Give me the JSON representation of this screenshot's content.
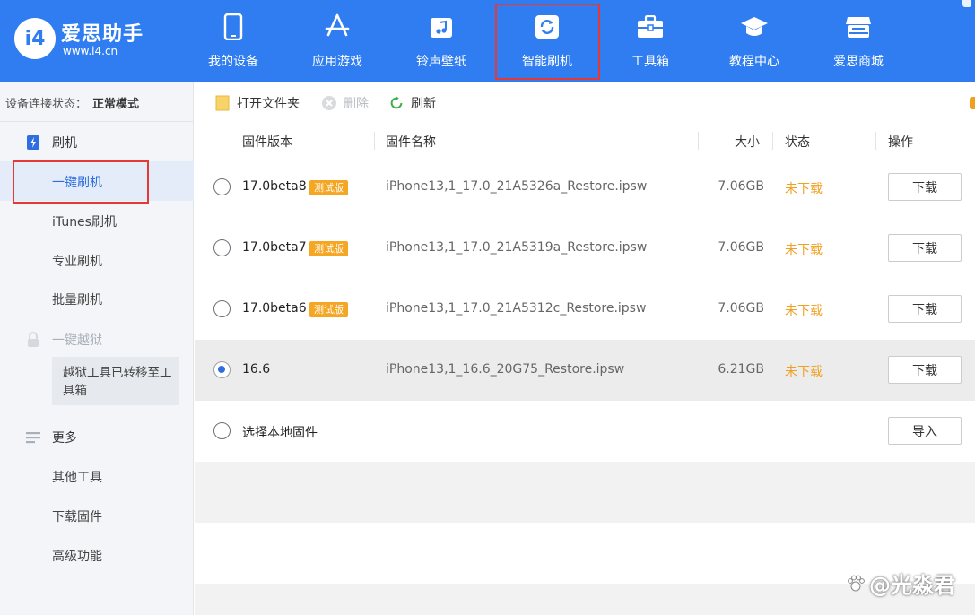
{
  "app": {
    "logo_mark": "i4",
    "name": "爱思助手",
    "url": "www.i4.cn"
  },
  "nav": [
    {
      "label": "我的设备",
      "icon": "phone-icon"
    },
    {
      "label": "应用游戏",
      "icon": "app-store-icon"
    },
    {
      "label": "铃声壁纸",
      "icon": "music-icon"
    },
    {
      "label": "智能刷机",
      "icon": "refresh-flash-icon",
      "active": true
    },
    {
      "label": "工具箱",
      "icon": "toolbox-icon"
    },
    {
      "label": "教程中心",
      "icon": "graduation-cap-icon"
    },
    {
      "label": "爱思商城",
      "icon": "shop-icon"
    }
  ],
  "sidebar": {
    "status_label": "设备连接状态：",
    "status_value": "正常模式",
    "groups": {
      "flash": {
        "label": "刷机",
        "icon": "flash-icon"
      },
      "jailbreak": {
        "label": "一键越狱",
        "icon": "lock-icon"
      },
      "more": {
        "label": "更多",
        "icon": "menu-icon"
      }
    },
    "items": {
      "one_click_flash": "一键刷机",
      "itunes_flash": "iTunes刷机",
      "pro_flash": "专业刷机",
      "batch_flash": "批量刷机",
      "jailbreak_note": "越狱工具已转移至工具箱",
      "other_tools": "其他工具",
      "download_firmware": "下载固件",
      "advanced": "高级功能"
    }
  },
  "toolbar": {
    "open_folder": "打开文件夹",
    "delete": "删除",
    "refresh": "刷新"
  },
  "table": {
    "headers": {
      "version": "固件版本",
      "name": "固件名称",
      "size": "大小",
      "status": "状态",
      "action": "操作"
    },
    "rows": [
      {
        "version": "17.0beta8",
        "tag": "测试版",
        "name": "iPhone13,1_17.0_21A5326a_Restore.ipsw",
        "size": "7.06GB",
        "status": "未下载",
        "action": "下载",
        "selected": false
      },
      {
        "version": "17.0beta7",
        "tag": "测试版",
        "name": "iPhone13,1_17.0_21A5319a_Restore.ipsw",
        "size": "7.06GB",
        "status": "未下载",
        "action": "下载",
        "selected": false
      },
      {
        "version": "17.0beta6",
        "tag": "测试版",
        "name": "iPhone13,1_17.0_21A5312c_Restore.ipsw",
        "size": "7.06GB",
        "status": "未下载",
        "action": "下载",
        "selected": false
      },
      {
        "version": "16.6",
        "tag": "",
        "name": "iPhone13,1_16.6_20G75_Restore.ipsw",
        "size": "6.21GB",
        "status": "未下载",
        "action": "下载",
        "selected": true
      }
    ],
    "local": {
      "label": "选择本地固件",
      "action": "导入"
    }
  },
  "watermark": "@光淼君",
  "colors": {
    "brand_blue": "#2f7df0",
    "highlight_red": "#e53935",
    "status_orange": "#f0a020",
    "tag_orange": "#f5a623",
    "radio_blue": "#2f6ee0"
  }
}
